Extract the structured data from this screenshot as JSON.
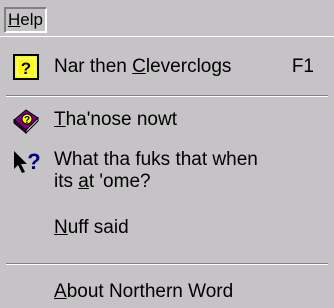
{
  "menubar": {
    "title_prefix": "H",
    "title_rest": "elp"
  },
  "menu": {
    "item1": {
      "icon": "help-question-icon",
      "pre": "Nar then ",
      "accel": "C",
      "post": "leverclogs",
      "shortcut": "F1"
    },
    "item2": {
      "icon": "help-book-icon",
      "accel": "T",
      "post": "ha'nose nowt"
    },
    "item3": {
      "icon": "whats-this-arrow-icon",
      "line1": "What tha fuks that when",
      "line2_pre": "its ",
      "accel": "a",
      "line2_post": "t 'ome?"
    },
    "item4": {
      "accel": "N",
      "post": "uff said"
    },
    "item5": {
      "accel": "A",
      "post": "bout Northern Word"
    }
  }
}
